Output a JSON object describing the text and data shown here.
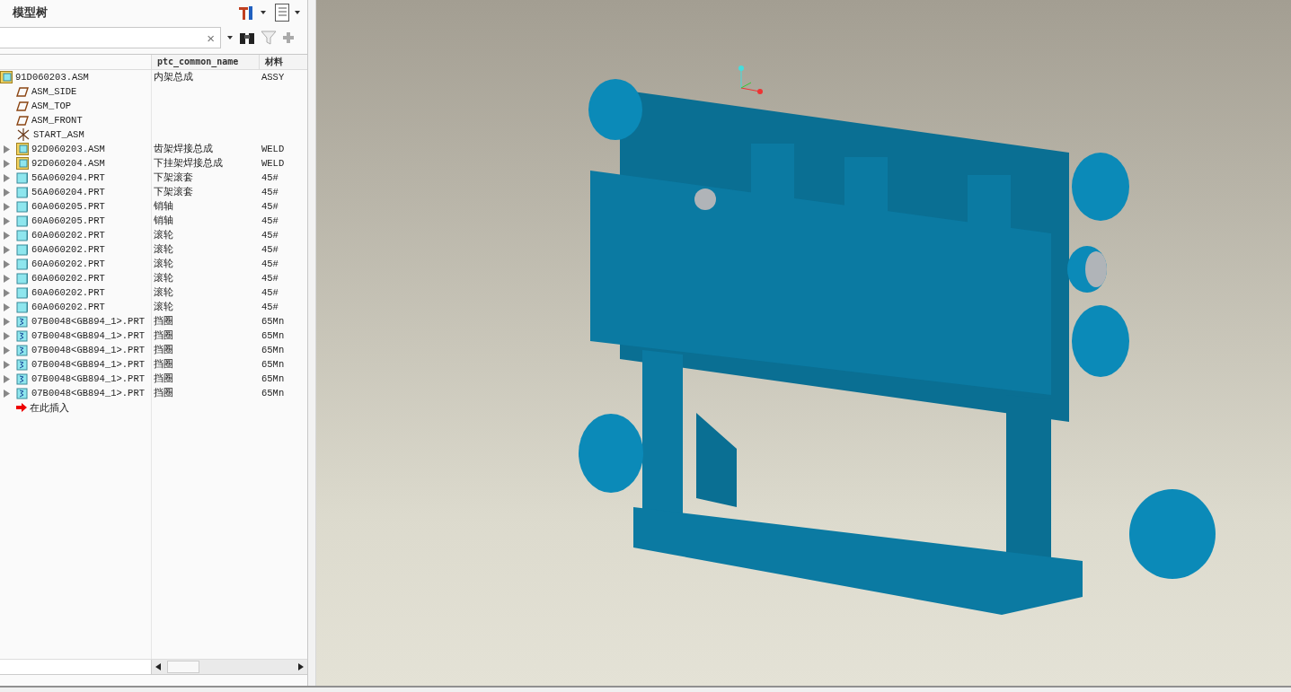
{
  "panel": {
    "title": "模型树"
  },
  "search": {
    "clear": "×"
  },
  "table": {
    "columns": [
      "ptc_common_name",
      "材料"
    ],
    "rows": [
      {
        "kind": "asm",
        "name": "91D060203.ASM",
        "common_name": "内架总成",
        "material": "ASSY",
        "children": [
          {
            "kind": "plane",
            "name": "ASM_SIDE"
          },
          {
            "kind": "plane",
            "name": "ASM_TOP"
          },
          {
            "kind": "plane",
            "name": "ASM_FRONT"
          },
          {
            "kind": "csys",
            "name": "START_ASM"
          },
          {
            "kind": "asm",
            "name": "92D060203.ASM",
            "common_name": "齿架焊接总成",
            "material": "WELD",
            "expanded": false
          },
          {
            "kind": "asm",
            "name": "92D060204.ASM",
            "common_name": "下挂架焊接总成",
            "material": "WELD",
            "expanded": false
          },
          {
            "kind": "part",
            "name": "56A060204.PRT",
            "common_name": "下架滚套",
            "material": "45#",
            "expanded": false
          },
          {
            "kind": "part",
            "name": "56A060204.PRT",
            "common_name": "下架滚套",
            "material": "45#",
            "expanded": false
          },
          {
            "kind": "part",
            "name": "60A060205.PRT",
            "common_name": "销轴",
            "material": "45#",
            "expanded": false
          },
          {
            "kind": "part",
            "name": "60A060205.PRT",
            "common_name": "销轴",
            "material": "45#",
            "expanded": false
          },
          {
            "kind": "part",
            "name": "60A060202.PRT",
            "common_name": "滚轮",
            "material": "45#",
            "expanded": false
          },
          {
            "kind": "part",
            "name": "60A060202.PRT",
            "common_name": "滚轮",
            "material": "45#",
            "expanded": false
          },
          {
            "kind": "part",
            "name": "60A060202.PRT",
            "common_name": "滚轮",
            "material": "45#",
            "expanded": false
          },
          {
            "kind": "part",
            "name": "60A060202.PRT",
            "common_name": "滚轮",
            "material": "45#",
            "expanded": false
          },
          {
            "kind": "part",
            "name": "60A060202.PRT",
            "common_name": "滚轮",
            "material": "45#",
            "expanded": false
          },
          {
            "kind": "part",
            "name": "60A060202.PRT",
            "common_name": "滚轮",
            "material": "45#",
            "expanded": false
          },
          {
            "kind": "stdpart",
            "name": "07B0048<GB894_1>.PRT",
            "common_name": "挡圈",
            "material": "65Mn",
            "expanded": false
          },
          {
            "kind": "stdpart",
            "name": "07B0048<GB894_1>.PRT",
            "common_name": "挡圈",
            "material": "65Mn",
            "expanded": false
          },
          {
            "kind": "stdpart",
            "name": "07B0048<GB894_1>.PRT",
            "common_name": "挡圈",
            "material": "65Mn",
            "expanded": false
          },
          {
            "kind": "stdpart",
            "name": "07B0048<GB894_1>.PRT",
            "common_name": "挡圈",
            "material": "65Mn",
            "expanded": false
          },
          {
            "kind": "stdpart",
            "name": "07B0048<GB894_1>.PRT",
            "common_name": "挡圈",
            "material": "65Mn",
            "expanded": false
          },
          {
            "kind": "stdpart",
            "name": "07B0048<GB894_1>.PRT",
            "common_name": "挡圈",
            "material": "65Mn",
            "expanded": false
          },
          {
            "kind": "insert",
            "name": "在此插入"
          }
        ]
      }
    ]
  }
}
